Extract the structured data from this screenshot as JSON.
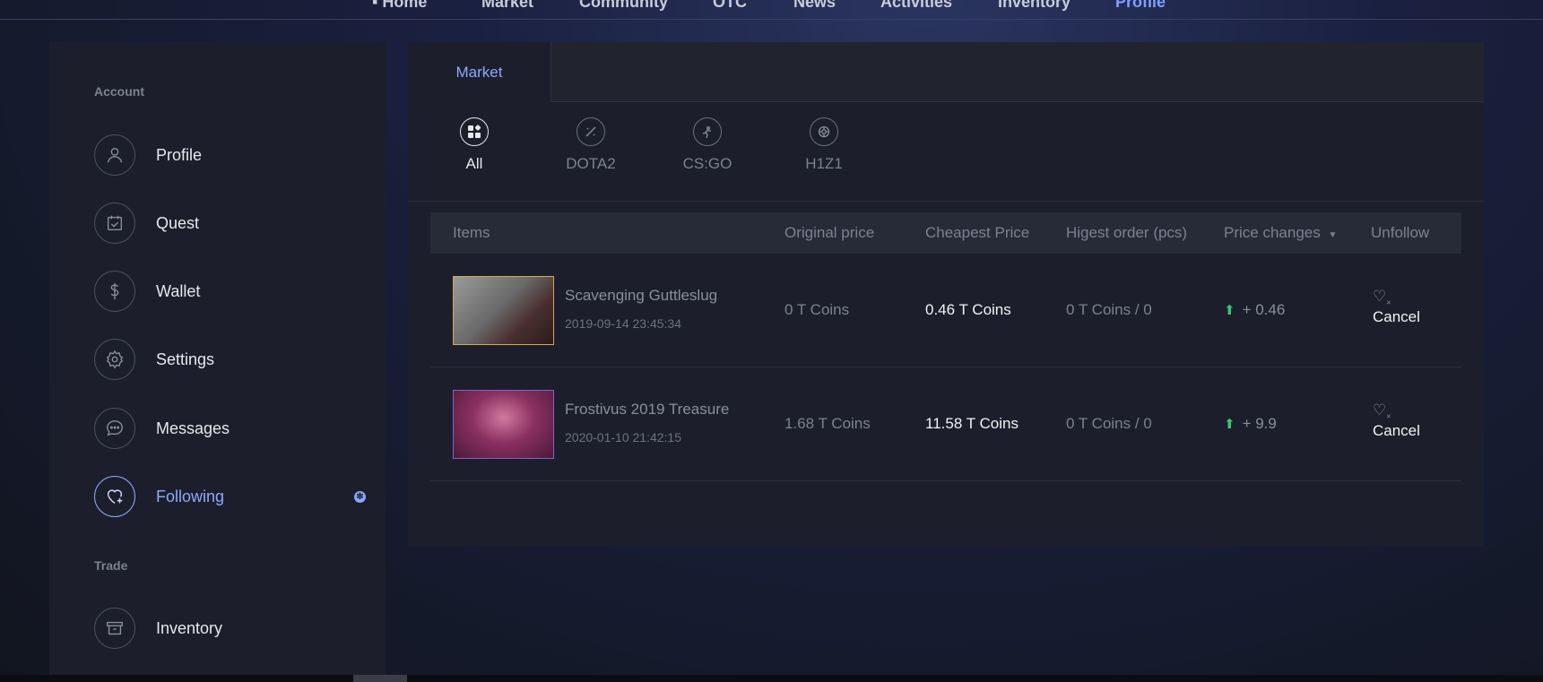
{
  "topnav": {
    "items": [
      "Home",
      "Market",
      "Community",
      "OTC",
      "News",
      "Activities",
      "Inventory",
      "Profile"
    ],
    "active": "Profile"
  },
  "sidebar": {
    "sections": [
      {
        "title": "Account"
      },
      {
        "title": "Trade"
      }
    ],
    "items": [
      {
        "label": "Profile",
        "icon": "user-icon"
      },
      {
        "label": "Quest",
        "icon": "calendar-check-icon"
      },
      {
        "label": "Wallet",
        "icon": "dollar-icon"
      },
      {
        "label": "Settings",
        "icon": "gear-icon"
      },
      {
        "label": "Messages",
        "icon": "chat-icon"
      },
      {
        "label": "Following",
        "icon": "heart-plus-icon",
        "active": true
      },
      {
        "label": "Inventory",
        "icon": "box-icon"
      }
    ]
  },
  "main": {
    "tab": "Market",
    "games": [
      {
        "label": "All",
        "icon": "grid-icon",
        "active": true
      },
      {
        "label": "DOTA2",
        "icon": "dota-icon"
      },
      {
        "label": "CS:GO",
        "icon": "csgo-icon"
      },
      {
        "label": "H1Z1",
        "icon": "h1z1-icon"
      }
    ],
    "table": {
      "headers": {
        "items": "Items",
        "original_price": "Original price",
        "cheapest_price": "Cheapest Price",
        "highest_order": "Higest order (pcs)",
        "price_changes": "Price changes",
        "unfollow": "Unfollow"
      },
      "rows": [
        {
          "name": "Scavenging Guttleslug",
          "date": "2019-09-14 23:45:34",
          "original_price": "0 T Coins",
          "cheapest_price": "0.46 T Coins",
          "highest_order": "0 T Coins / 0",
          "price_change": "+ 0.46",
          "action": "Cancel"
        },
        {
          "name": "Frostivus 2019 Treasure",
          "date": "2020-01-10 21:42:15",
          "original_price": "1.68 T Coins",
          "cheapest_price": "11.58 T Coins",
          "highest_order": "0 T Coins / 0",
          "price_change": "+ 9.9",
          "action": "Cancel"
        }
      ]
    }
  },
  "colors": {
    "accent": "#8ca8ff",
    "up": "#3fc46a",
    "panel": "#1c1f2b"
  }
}
